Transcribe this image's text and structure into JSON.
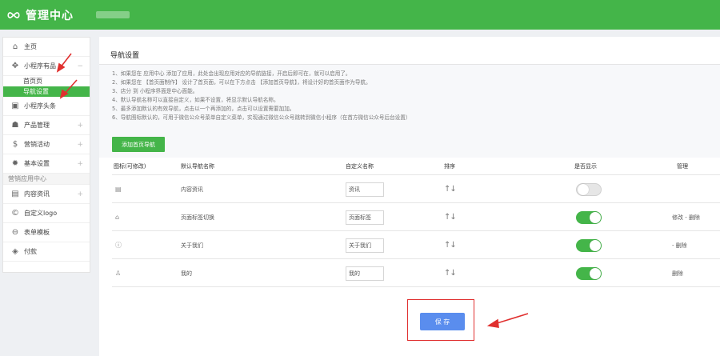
{
  "app": {
    "title": "管理中心"
  },
  "sidebar": {
    "items": [
      {
        "label": "主页",
        "icon": "home-icon"
      },
      {
        "label": "小程序有品",
        "icon": "move-icon"
      },
      {
        "label": "小程序头条",
        "icon": "square-icon"
      },
      {
        "label": "产品管理",
        "icon": "users-icon"
      },
      {
        "label": "营销活动",
        "icon": "bag-icon"
      },
      {
        "label": "基本设置",
        "icon": "gear-icon"
      }
    ],
    "subitems": [
      {
        "label": "首页页"
      },
      {
        "label": "导航设置"
      }
    ],
    "section": "营销应用中心",
    "section_items": [
      {
        "label": "内容资讯",
        "icon": "doc-icon"
      },
      {
        "label": "自定义logo",
        "icon": "copyright-icon"
      },
      {
        "label": "表单模板",
        "icon": "minus-circle-icon"
      },
      {
        "label": "付款",
        "icon": "cube-icon"
      }
    ]
  },
  "page": {
    "title": "导航设置",
    "notice": [
      "1、如果您在 应用中心 添加了应用，此处会出现应用对应的导航链接，开启后即可在，就可以启用了。",
      "2、如果您在 【首页面制作】 设计了首页面，可以在下方点击 【添加首页导航】，将设计好的首页面作为导航。",
      "3、店分 到 小程序界面是中心面能。",
      "4、默认导航名称可以直接自定义，如果不设置，将显示默认导航名称。",
      "5、最多添加默认的有效导航，点击以一个再添加的，点击可以设置需要加加。",
      "6、导航图标默认的，可用于微信公众号菜单自定义菜单，实现通过微信公众号跳转到微信小程序（在首方微信公众号后台设置）"
    ],
    "add_button": "添加首页导航",
    "columns": {
      "icon": "图标(可修改)",
      "default_name": "默认导航名称",
      "custom_name": "自定义名称",
      "sort": "排序",
      "show": "是否显示",
      "manage": "管理"
    },
    "rows": [
      {
        "icon": "doc-icon",
        "icon_glyph": "▤",
        "default_name": "内容资讯",
        "custom_name": "资讯",
        "sort": "↑↓",
        "shown": false,
        "toggle": "off",
        "manage": ""
      },
      {
        "icon": "home-icon",
        "icon_glyph": "⌂",
        "default_name": "页面标签切换",
        "custom_name": "页面标签",
        "sort": "↑↓",
        "shown": true,
        "toggle": "on",
        "manage": "修改 - 删除"
      },
      {
        "icon": "info-icon",
        "icon_glyph": "ⓘ",
        "default_name": "关于我们",
        "custom_name": "关于我们",
        "sort": "↑↓",
        "shown": true,
        "toggle": "on",
        "manage": "- 删除"
      },
      {
        "icon": "user-icon",
        "icon_glyph": "♙",
        "default_name": "我的",
        "custom_name": "我的",
        "sort": "↑↓",
        "shown": true,
        "toggle": "on",
        "manage": "删除"
      }
    ],
    "save_button": "保 存"
  },
  "colors": {
    "brand": "#44b549",
    "link": "#2d8cf0",
    "save": "#5a8dee",
    "annotation": "#e0302f"
  }
}
